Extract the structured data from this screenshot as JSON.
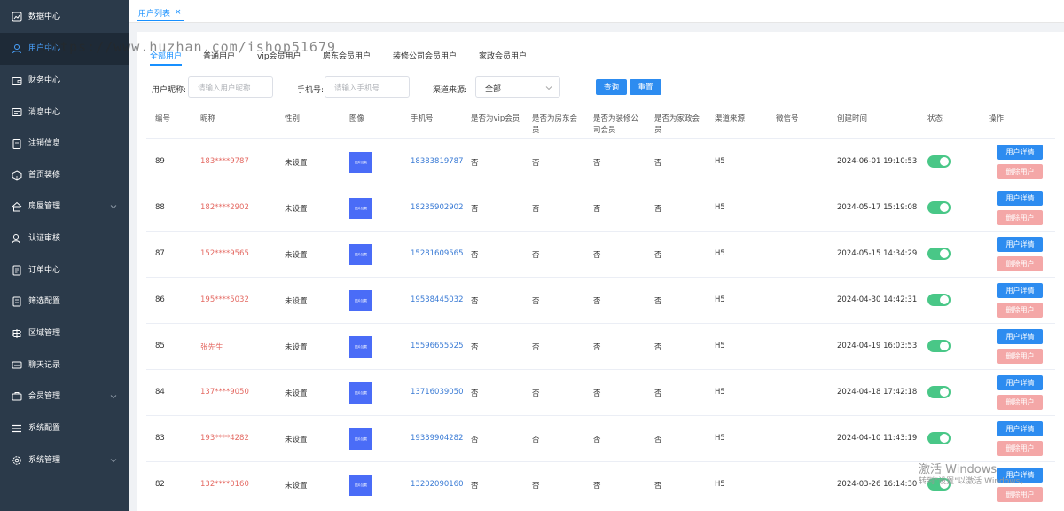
{
  "sidebar": {
    "items": [
      {
        "label": "数据中心",
        "icon": "chart-icon"
      },
      {
        "label": "用户中心",
        "icon": "user-icon"
      },
      {
        "label": "财务中心",
        "icon": "wallet-icon"
      },
      {
        "label": "消息中心",
        "icon": "message-icon"
      },
      {
        "label": "注销信息",
        "icon": "clipboard-icon"
      },
      {
        "label": "首页装修",
        "icon": "box-icon"
      },
      {
        "label": "房屋管理",
        "icon": "home-icon"
      },
      {
        "label": "认证审核",
        "icon": "user-check-icon"
      },
      {
        "label": "订单中心",
        "icon": "document-icon"
      },
      {
        "label": "筛选配置",
        "icon": "filter-doc-icon"
      },
      {
        "label": "区域管理",
        "icon": "signpost-icon"
      },
      {
        "label": "聊天记录",
        "icon": "chat-icon"
      },
      {
        "label": "会员管理",
        "icon": "member-icon"
      },
      {
        "label": "系统配置",
        "icon": "list-icon"
      },
      {
        "label": "系统管理",
        "icon": "gear-icon"
      }
    ]
  },
  "topbar": {
    "tab_label": "用户列表",
    "close_symbol": "×"
  },
  "watermark": "https://www.huzhan.com/ishop51679",
  "subtabs": [
    "全部用户",
    "普通用户",
    "vip会员用户",
    "房东会员用户",
    "装修公司会员用户",
    "家政会员用户"
  ],
  "filters": {
    "nickname_label": "用户昵称:",
    "nickname_placeholder": "请输入用户昵称",
    "phone_label": "手机号:",
    "phone_placeholder": "请输入手机号",
    "channel_label": "渠道来源:",
    "channel_value": "全部",
    "query_button": "查询",
    "reset_button": "重置"
  },
  "table": {
    "headers": [
      "编号",
      "昵称",
      "性别",
      "图像",
      "手机号",
      "是否为vip会员",
      "是否为房东会员",
      "是否为装修公司会员",
      "是否为家政会员",
      "渠道来源",
      "微信号",
      "创建时间",
      "状态",
      "操作"
    ],
    "avatar_text": "图片加载",
    "detail_button": "用户详情",
    "delete_button": "删除用户",
    "rows": [
      {
        "id": "89",
        "nick": "183****9787",
        "gender": "未设置",
        "phone": "18383819787",
        "vip": "否",
        "landlord": "否",
        "deco": "否",
        "house": "否",
        "channel": "H5",
        "wechat": "",
        "created": "2024-06-01 19:10:53"
      },
      {
        "id": "88",
        "nick": "182****2902",
        "gender": "未设置",
        "phone": "18235902902",
        "vip": "否",
        "landlord": "否",
        "deco": "否",
        "house": "否",
        "channel": "H5",
        "wechat": "",
        "created": "2024-05-17 15:19:08"
      },
      {
        "id": "87",
        "nick": "152****9565",
        "gender": "未设置",
        "phone": "15281609565",
        "vip": "否",
        "landlord": "否",
        "deco": "否",
        "house": "否",
        "channel": "H5",
        "wechat": "",
        "created": "2024-05-15 14:34:29"
      },
      {
        "id": "86",
        "nick": "195****5032",
        "gender": "未设置",
        "phone": "19538445032",
        "vip": "否",
        "landlord": "否",
        "deco": "否",
        "house": "否",
        "channel": "H5",
        "wechat": "",
        "created": "2024-04-30 14:42:31"
      },
      {
        "id": "85",
        "nick": "张先生",
        "gender": "未设置",
        "phone": "15596655525",
        "vip": "否",
        "landlord": "否",
        "deco": "否",
        "house": "否",
        "channel": "H5",
        "wechat": "",
        "created": "2024-04-19 16:03:53"
      },
      {
        "id": "84",
        "nick": "137****9050",
        "gender": "未设置",
        "phone": "13716039050",
        "vip": "否",
        "landlord": "否",
        "deco": "否",
        "house": "否",
        "channel": "H5",
        "wechat": "",
        "created": "2024-04-18 17:42:18"
      },
      {
        "id": "83",
        "nick": "193****4282",
        "gender": "未设置",
        "phone": "19339904282",
        "vip": "否",
        "landlord": "否",
        "deco": "否",
        "house": "否",
        "channel": "H5",
        "wechat": "",
        "created": "2024-04-10 11:43:19"
      },
      {
        "id": "82",
        "nick": "132****0160",
        "gender": "未设置",
        "phone": "13202090160",
        "vip": "否",
        "landlord": "否",
        "deco": "否",
        "house": "否",
        "channel": "H5",
        "wechat": "",
        "created": "2024-03-26 16:14:30"
      }
    ]
  },
  "windows_activation": {
    "title": "激活 Windows",
    "subtitle": "转到\"设置\"以激活 Windows。"
  },
  "colors": {
    "sidebar_bg": "#2b3a4a",
    "accent": "#2d8cf0",
    "toggle_on": "#49c787",
    "delete_btn": "#f4a7a7",
    "nick_red": "#e46a63"
  }
}
